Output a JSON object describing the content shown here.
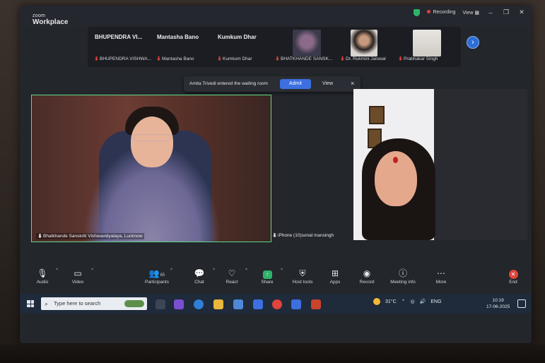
{
  "window": {
    "brand_small": "zoom",
    "brand_big": "Workplace",
    "recording_label": "Recording",
    "view_label": "View"
  },
  "strip": {
    "tiles": [
      {
        "name": "BHUPENDRA VI...",
        "sub": "BHUPENDRA VISHWA..."
      },
      {
        "name": "Mantasha Bano",
        "sub": "Mantasha Bano"
      },
      {
        "name": "Kumkum Dhar",
        "sub": "Kumkum Dhar"
      },
      {
        "name": "",
        "sub": "BHATKHANDE SANSK..."
      },
      {
        "name": "",
        "sub": "Dr. Rukmini Jaiswal"
      },
      {
        "name": "",
        "sub": "Prabhakar Singh"
      }
    ],
    "next_label": "›"
  },
  "banner": {
    "message": "Amita Trivedi entered the waiting room",
    "admit": "Admit",
    "view": "View",
    "close": "×"
  },
  "videos": {
    "main_name": "Bhatkhande Sanskriti Vishwavidyalaya, Lucknow",
    "second_name": "iPhone (10)sonal mansingh"
  },
  "controls": {
    "audio": "Audio",
    "video": "Video",
    "participants": "Participants",
    "participants_count": "65",
    "chat": "Chat",
    "react": "React",
    "share": "Share",
    "host_tools": "Host tools",
    "apps": "Apps",
    "record": "Record",
    "meeting_info": "Meeting info",
    "more": "More",
    "end": "End"
  },
  "taskbar": {
    "search_placeholder": "Type here to search",
    "temperature": "31°C",
    "lang": "ENG",
    "time": "10:19",
    "date": "17-06-2025"
  },
  "colors": {
    "accent": "#3d6fe0",
    "active_speaker": "#5fd98a",
    "end": "#e0443a",
    "share": "#2fb36a"
  }
}
